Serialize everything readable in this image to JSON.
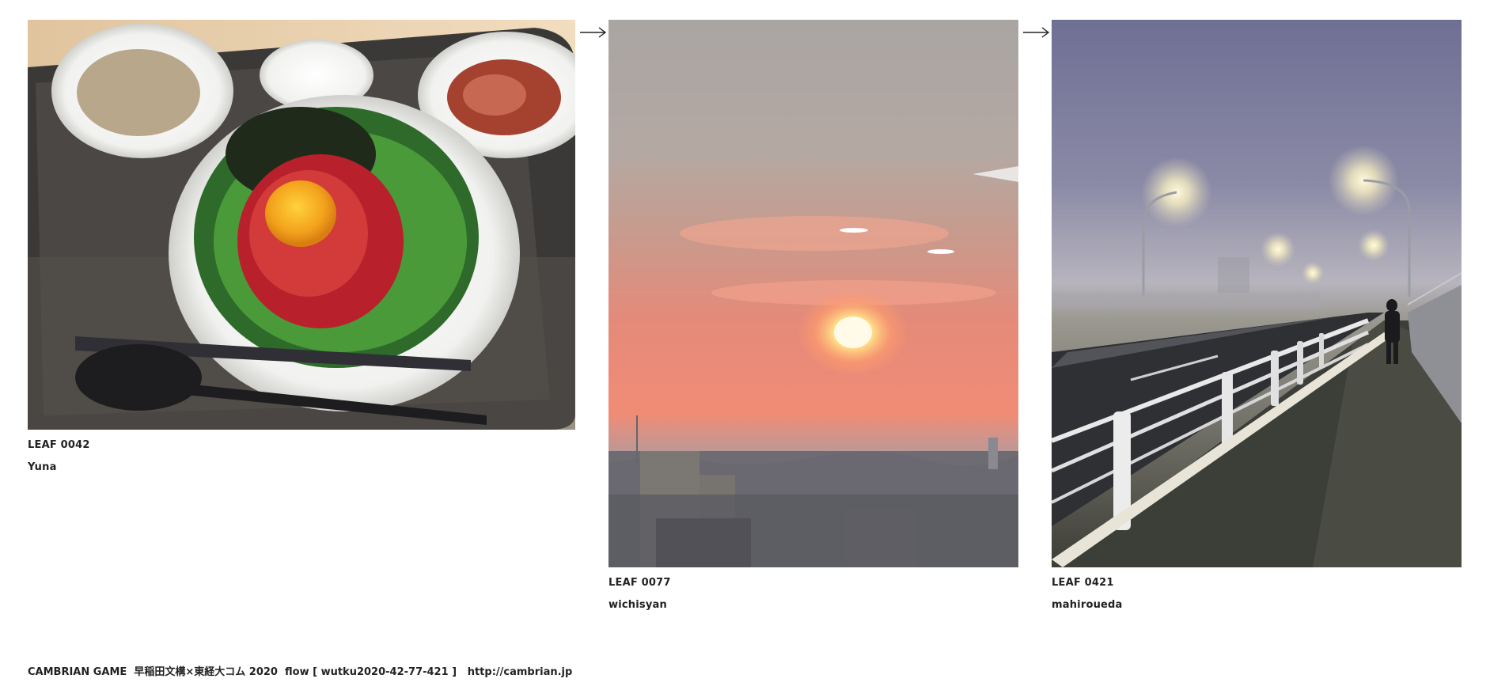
{
  "leaves": [
    {
      "id": "LEAF 0042",
      "author": "Yuna",
      "photo_subject": "yukhoe rice bowl on tray"
    },
    {
      "id": "LEAF 0077",
      "author": "wichisyan",
      "photo_subject": "sunset over city"
    },
    {
      "id": "LEAF 0421",
      "author": "mahiroueda",
      "photo_subject": "foggy bridge at night"
    }
  ],
  "arrows": [
    "right-arrow-icon",
    "right-arrow-icon"
  ],
  "footer": {
    "text": "CAMBRIAN GAME  早稲田文構×東経大コム 2020  flow [ wutku2020-42-77-421 ]   ",
    "link": "http://cambrian.jp"
  }
}
